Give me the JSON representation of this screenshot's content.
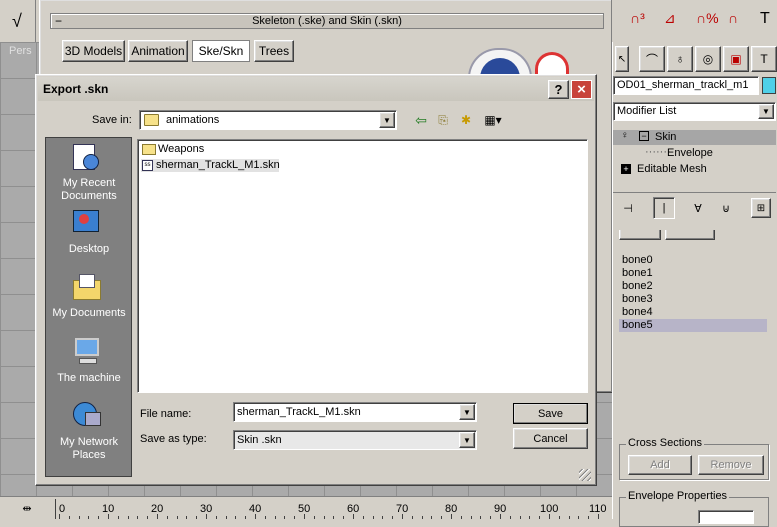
{
  "background_panel": {
    "title": "Skeleton (.ske) and Skin (.skn)",
    "tabs": [
      "3D Models",
      "Animation",
      "Ske/Skn",
      "Trees"
    ],
    "active_tab": 2,
    "viewport_label": "Pers"
  },
  "command_panel": {
    "object_name": "OD01_sherman_trackl_m1",
    "modifier_list": "Modifier List",
    "stack": [
      {
        "label": "Skin",
        "level": 0,
        "selected": true
      },
      {
        "label": "Envelope",
        "level": 1,
        "selected": false
      },
      {
        "label": "Editable Mesh",
        "level": 0,
        "selected": false
      }
    ],
    "bones": [
      "bone0",
      "bone1",
      "bone2",
      "bone3",
      "bone4",
      "bone5"
    ],
    "selected_bone": 5,
    "cross_sections": {
      "title": "Cross Sections",
      "add": "Add",
      "remove": "Remove"
    },
    "envelope_properties": {
      "title": "Envelope Properties"
    }
  },
  "timeline": {
    "ticks": [
      "0",
      "10",
      "20",
      "30",
      "40",
      "50",
      "60",
      "70",
      "80",
      "90",
      "100",
      "110"
    ]
  },
  "dialog": {
    "title": "Export .skn",
    "save_in_label": "Save in:",
    "save_in_value": "animations",
    "places": [
      {
        "label": "My Recent Documents",
        "icon": "recent-documents-icon"
      },
      {
        "label": "Desktop",
        "icon": "desktop-icon"
      },
      {
        "label": "My Documents",
        "icon": "my-documents-icon"
      },
      {
        "label": "The machine",
        "icon": "computer-icon"
      },
      {
        "label": "My Network Places",
        "icon": "network-places-icon"
      }
    ],
    "files": [
      {
        "name": "Weapons",
        "type": "folder"
      },
      {
        "name": "sherman_TrackL_M1.skn",
        "type": "file"
      }
    ],
    "file_name_label": "File name:",
    "file_name_value": "sherman_TrackL_M1.skn",
    "save_as_type_label": "Save as type:",
    "save_as_type_value": "Skin .skn",
    "save_button": "Save",
    "cancel_button": "Cancel",
    "help_button": "?",
    "close_button": "×"
  }
}
